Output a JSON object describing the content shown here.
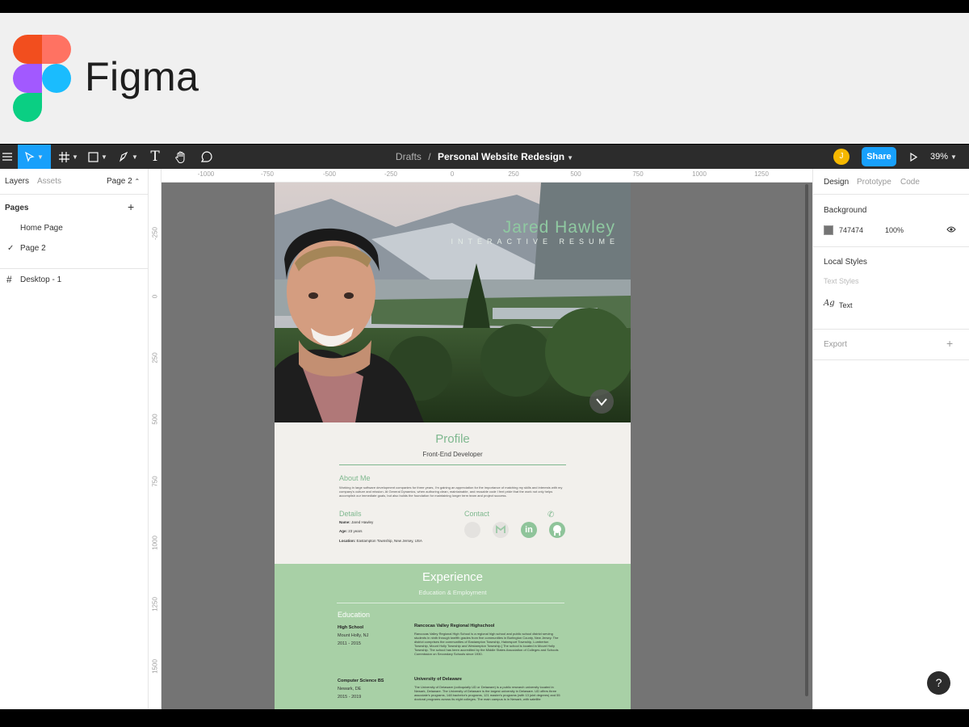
{
  "banner": {
    "wordmark": "Figma"
  },
  "toolbar": {
    "breadcrumb_folder": "Drafts",
    "breadcrumb_sep": "/",
    "file_name": "Personal Website Redesign",
    "avatar_initial": "J",
    "share_label": "Share",
    "zoom_level": "39%"
  },
  "left_panel": {
    "tabs": {
      "layers": "Layers",
      "assets": "Assets",
      "page_selector": "Page 2"
    },
    "pages_title": "Pages",
    "pages": [
      "Home Page",
      "Page 2"
    ],
    "selected_page": "Page 2",
    "layers": [
      "Desktop - 1"
    ]
  },
  "rulers": {
    "top": [
      "-1000",
      "-750",
      "-500",
      "-250",
      "0",
      "250",
      "500",
      "750",
      "1000",
      "1250"
    ],
    "left": [
      "-250",
      "0",
      "250",
      "500",
      "750",
      "1000",
      "1250",
      "1500"
    ]
  },
  "resume": {
    "hero_name": "Jared Hawley",
    "hero_subtitle": "INTERACTIVE RESUME",
    "profile_title": "Profile",
    "profile_role": "Front-End Developer",
    "about_heading": "About Me",
    "about_text": "Working in large software development companies for three years, I'm gaining an appreciation for the importance of matching my skills and interests with my company's culture and mission. At General Dynamics, when authoring clean, maintainable, and reusable code I feel pride that the work not only helps accomplish our immediate goals, but also builds the foundation for maintaining longer term team and project success.",
    "details_heading": "Details",
    "details": [
      {
        "label": "Name:",
        "value": "Jared Hawley"
      },
      {
        "label": "Age:",
        "value": "23 years"
      },
      {
        "label": "Location:",
        "value": "Eastampton Township, New Jersey, USA"
      }
    ],
    "contact_heading": "Contact",
    "experience_title": "Experience",
    "experience_subtitle": "Education & Employment",
    "education_heading": "Education",
    "education": [
      {
        "degree": "High School",
        "place": "Mount Holly, NJ",
        "years": "2011 - 2015",
        "school": "Rancocas Valley Regional Highschool",
        "description": "Rancocas Valley Regional High School is a regional high school and public school district serving students in ninth through twelfth grades from five communities in Burlington County, New Jersey. The district comprises the communities of Eastampton Township, Hainesport Township, Lumberton Township, Mount Holly Township and Westampton Township.[ The school is located in Mount Holly Township. The school has been accredited by the Middle States Association of Colleges and Schools Commission on Secondary Schools since 1930."
      },
      {
        "degree": "Computer Science BS",
        "place": "Newark, DE",
        "years": "2015 - 2019",
        "school": "University of Delaware",
        "description": "The University of Delaware (colloquially UD or Delaware) is a public research university located in Newark, Delaware. The University of Delaware is the largest university in Delaware. UD offers three associate's programs, 148 bachelor's programs, 121 master's programs (with 13 joint degrees) and 55 doctoral programs across its eight colleges. The main campus is in Newark, with satellite"
      }
    ]
  },
  "right_panel": {
    "tabs": {
      "design": "Design",
      "prototype": "Prototype",
      "code": "Code"
    },
    "background_title": "Background",
    "background_hex": "747474",
    "background_opacity": "100%",
    "local_styles_title": "Local Styles",
    "text_styles_title": "Text Styles",
    "text_style_name": "Text",
    "export_title": "Export"
  },
  "help_label": "?",
  "colors": {
    "toolbar": "#2c2c2c",
    "accent": "#18a0fb",
    "canvas": "#747474",
    "resume_green": "#7fb88f",
    "experience_bg": "#a8d0a6"
  },
  "icons": [
    "menu-icon",
    "move-tool-icon",
    "frame-tool-icon",
    "shape-tool-icon",
    "pen-tool-icon",
    "text-tool-icon",
    "hand-tool-icon",
    "comment-tool-icon",
    "play-icon",
    "eye-icon",
    "chevron-down-icon",
    "help-icon"
  ]
}
